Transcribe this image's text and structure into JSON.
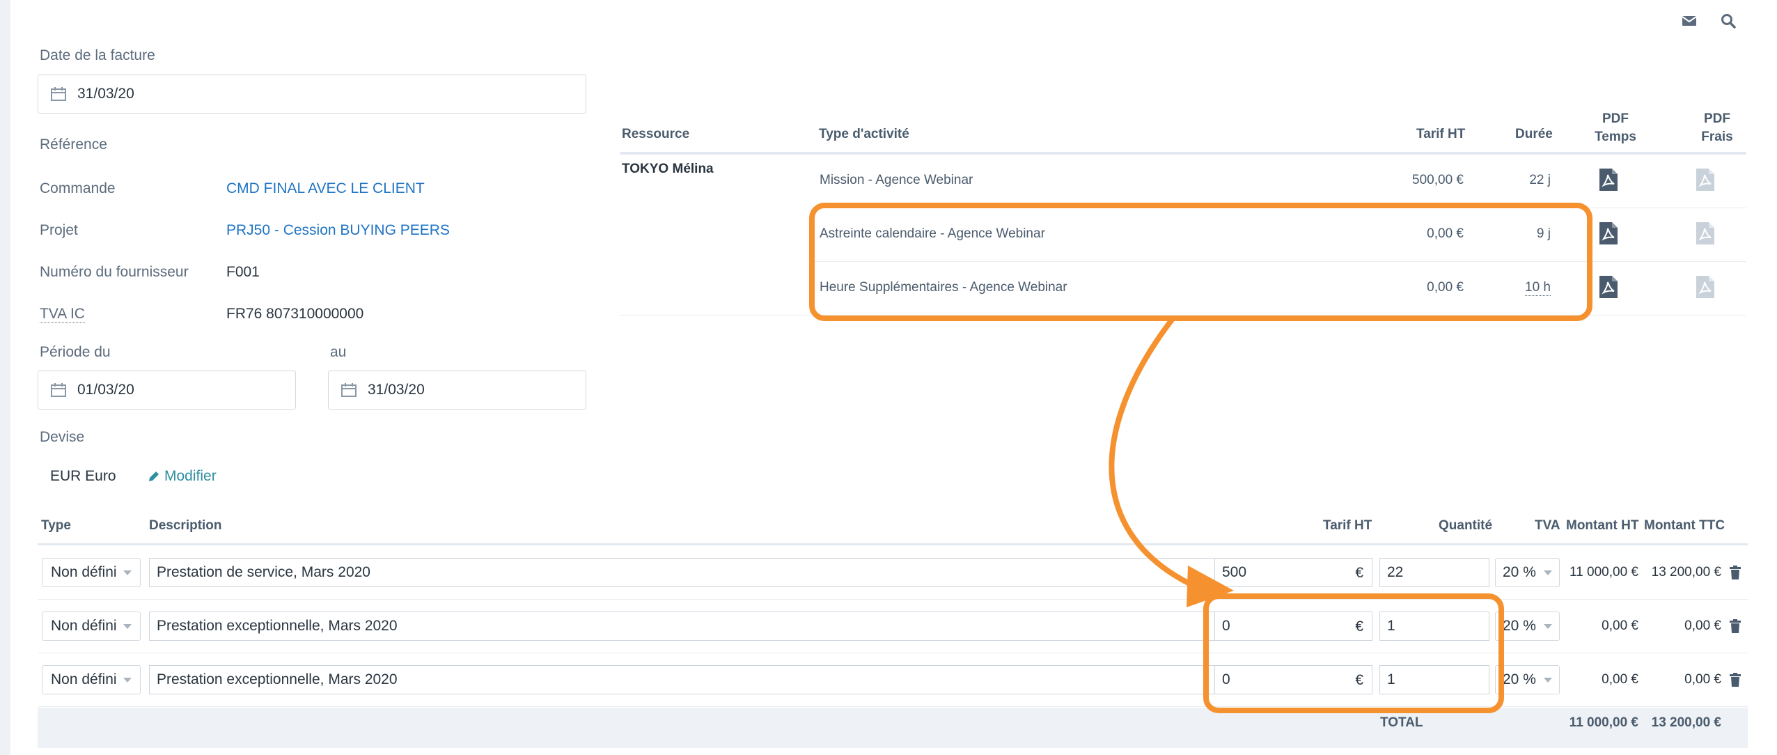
{
  "invoice": {
    "date_label": "Date de la facture",
    "date_value": "31/03/20",
    "reference_label": "Référence",
    "commande_label": "Commande",
    "commande_value": "CMD FINAL AVEC LE CLIENT",
    "projet_label": "Projet",
    "projet_value": "PRJ50 - Cession BUYING PEERS",
    "fournisseur_label": "Numéro du fournisseur",
    "fournisseur_value": "F001",
    "tva_label": "TVA IC",
    "tva_value": "FR76 807310000000",
    "periode_label": "Période du",
    "periode_from": "01/03/20",
    "au_label": "au",
    "periode_to": "31/03/20",
    "devise_label": "Devise",
    "devise_value": "EUR Euro",
    "modifier_label": "Modifier"
  },
  "resources": {
    "headers": {
      "ressource": "Ressource",
      "type": "Type d'activité",
      "tarif": "Tarif HT",
      "duree": "Durée",
      "pdf_temps_1": "PDF",
      "pdf_temps_2": "Temps",
      "pdf_frais_1": "PDF",
      "pdf_frais_2": "Frais"
    },
    "name": "TOKYO Mélina",
    "rows": [
      {
        "type": "Mission - Agence Webinar",
        "tarif": "500,00 €",
        "duree": "22 j"
      },
      {
        "type": "Astreinte calendaire - Agence Webinar",
        "tarif": "0,00 €",
        "duree": "9 j"
      },
      {
        "type": "Heure Supplémentaires - Agence Webinar",
        "tarif": "0,00 €",
        "duree": "10 h"
      }
    ]
  },
  "lines": {
    "headers": {
      "type": "Type",
      "description": "Description",
      "tarif": "Tarif HT",
      "quantite": "Quantité",
      "tva": "TVA",
      "montant_ht": "Montant HT",
      "montant_ttc": "Montant TTC"
    },
    "rows": [
      {
        "type": "Non défini",
        "description": "Prestation de service, Mars 2020",
        "tarif": "500",
        "currency": "€",
        "quantite": "22",
        "tva": "20 %",
        "montant_ht": "11 000,00 €",
        "montant_ttc": "13 200,00 €"
      },
      {
        "type": "Non défini",
        "description": "Prestation exceptionnelle, Mars 2020",
        "tarif": "0",
        "currency": "€",
        "quantite": "1",
        "tva": "20 %",
        "montant_ht": "0,00 €",
        "montant_ttc": "0,00 €"
      },
      {
        "type": "Non défini",
        "description": "Prestation exceptionnelle, Mars 2020",
        "tarif": "0",
        "currency": "€",
        "quantite": "1",
        "tva": "20 %",
        "montant_ht": "0,00 €",
        "montant_ttc": "0,00 €"
      }
    ],
    "total_label": "TOTAL",
    "total_ht": "11 000,00 €",
    "total_ttc": "13 200,00 €"
  },
  "colors": {
    "annotation": "#f5922f",
    "link": "#1f74c4",
    "pdf_active": "#4a5b6d",
    "pdf_inactive": "#c9d1da"
  },
  "icons": [
    "envelope-icon",
    "search-icon",
    "calendar-icon",
    "pencil-icon",
    "pdf-icon",
    "chevron-down-icon",
    "trash-icon"
  ]
}
